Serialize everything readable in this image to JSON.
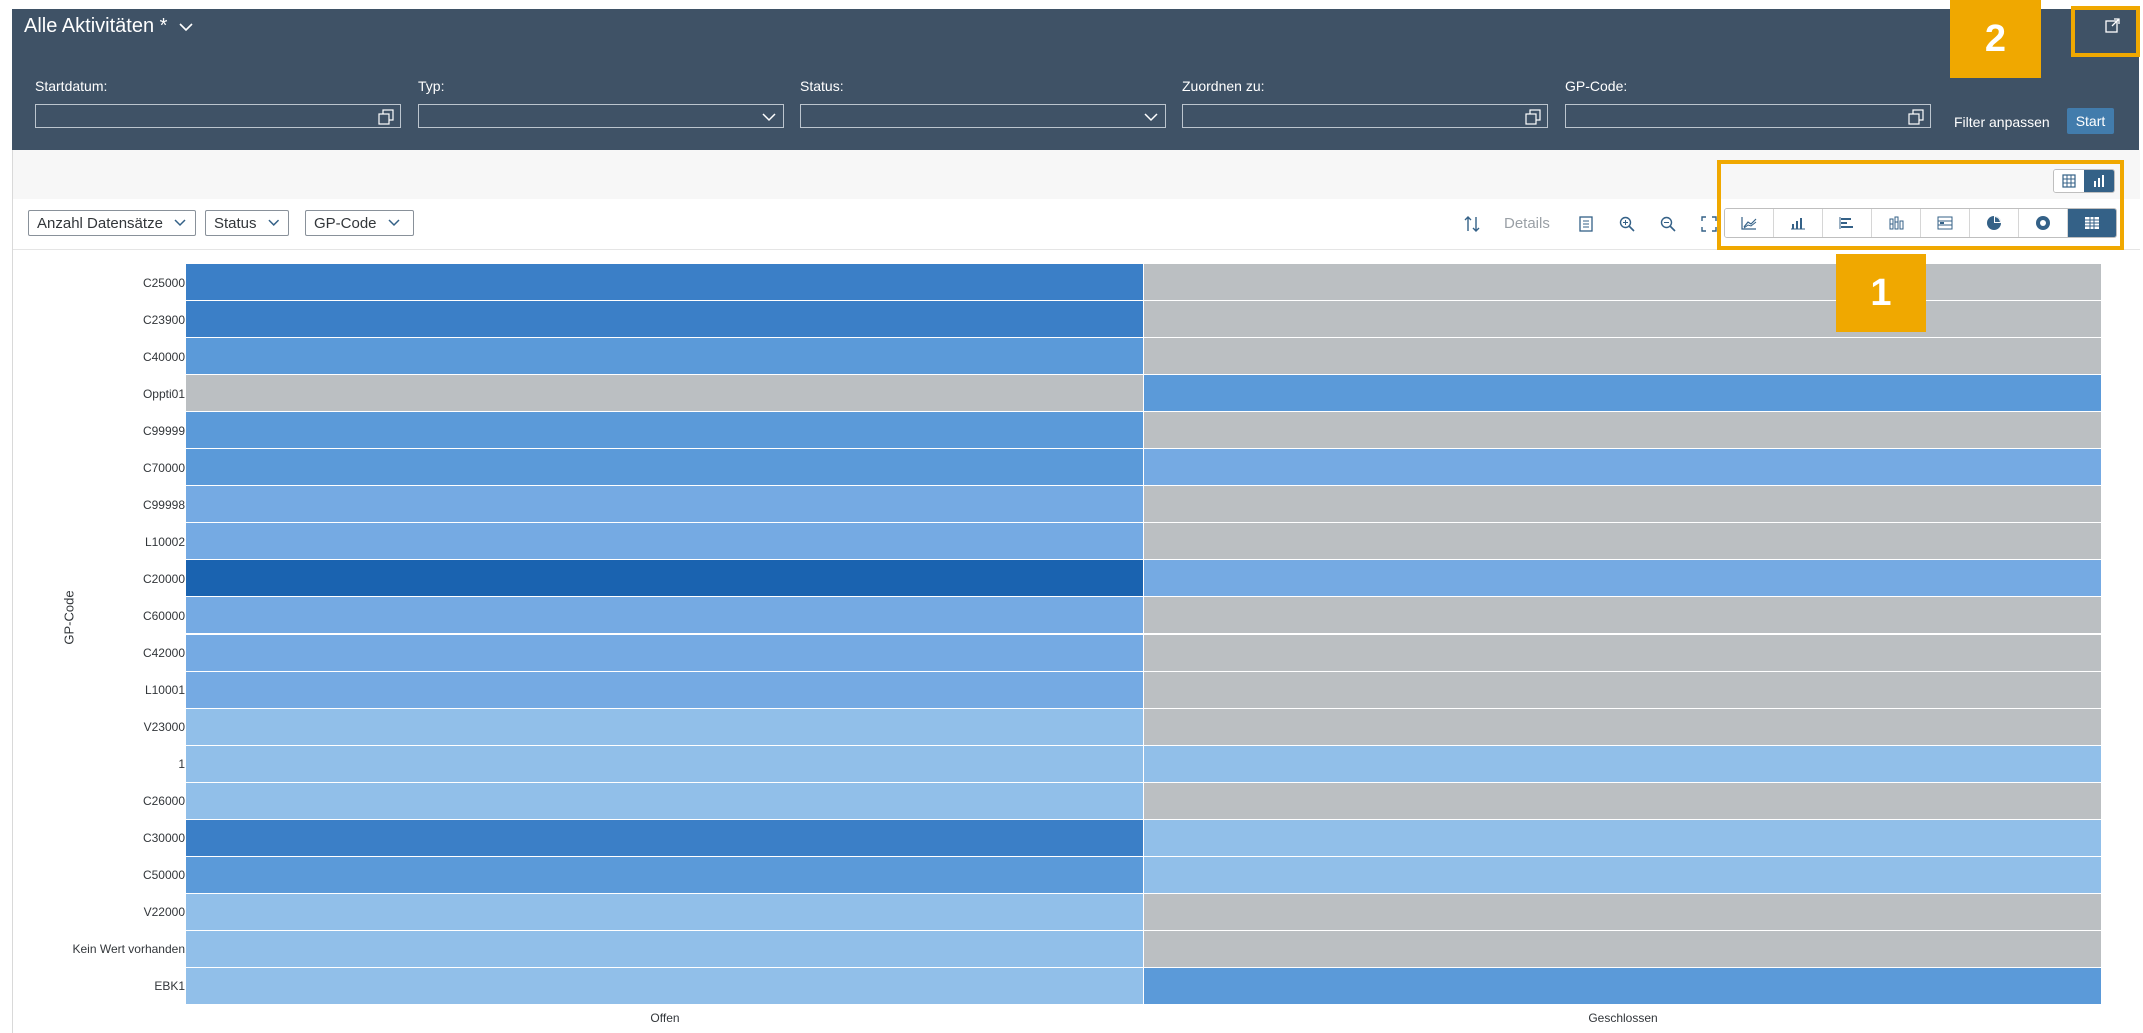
{
  "header": {
    "title": "Alle Aktivitäten *",
    "filters": [
      {
        "label": "Startdatum:",
        "value": "",
        "icon": "value-help-icon"
      },
      {
        "label": "Typ:",
        "value": "",
        "icon": "chevron-down-icon"
      },
      {
        "label": "Status:",
        "value": "",
        "icon": "chevron-down-icon"
      },
      {
        "label": "Zuordnen zu:",
        "value": "",
        "icon": "value-help-icon"
      },
      {
        "label": "GP-Code:",
        "value": "",
        "icon": "value-help-icon"
      }
    ],
    "adapt_filters": "Filter anpassen",
    "start": "Start"
  },
  "toolbar": {
    "measure_dropdown": "Anzahl Datensätze",
    "status_dropdown": "Status",
    "gpcode_dropdown": "GP-Code",
    "details": "Details",
    "view_toggle": [
      "table-view",
      "chart-view"
    ],
    "active_view": "chart-view",
    "chart_types": [
      "line-chart",
      "column-chart",
      "bar-chart",
      "stacked-column-chart",
      "combined-chart",
      "pie-chart",
      "donut-chart",
      "heatmap-chart"
    ],
    "active_chart_type": "heatmap-chart"
  },
  "annotations": {
    "badge1": "1",
    "badge2": "2",
    "highlight_color": "#f0a800"
  },
  "colors": {
    "header_bg": "#3f5266",
    "accent": "#427cac",
    "empty": "#bbbfc2"
  },
  "chart_data": {
    "type": "heatmap",
    "ylabel": "GP-Code",
    "x": [
      "Offen",
      "Geschlossen"
    ],
    "y": [
      "C25000",
      "C23900",
      "C40000",
      "Oppti01",
      "C99999",
      "C70000",
      "C99998",
      "L10002",
      "C20000",
      "C60000",
      "C42000",
      "L10001",
      "V23000",
      "1",
      "C26000",
      "C30000",
      "C50000",
      "V22000",
      "Kein Wert vorhanden",
      "EBK1"
    ],
    "values": [
      [
        4,
        0
      ],
      [
        4,
        0
      ],
      [
        3,
        0
      ],
      [
        0,
        3
      ],
      [
        3,
        0
      ],
      [
        3,
        2
      ],
      [
        2,
        0
      ],
      [
        2,
        0
      ],
      [
        5,
        2
      ],
      [
        2,
        0
      ],
      [
        2,
        0
      ],
      [
        2,
        0
      ],
      [
        1,
        0
      ],
      [
        1,
        1
      ],
      [
        1,
        0
      ],
      [
        4,
        1
      ],
      [
        3,
        1
      ],
      [
        1,
        0
      ],
      [
        1,
        0
      ],
      [
        1,
        3
      ]
    ],
    "color_scale": [
      "#bbbfc2",
      "#91bfe9",
      "#75aae3",
      "#5b9ad9",
      "#3b7fc7",
      "#1a63b0"
    ]
  }
}
